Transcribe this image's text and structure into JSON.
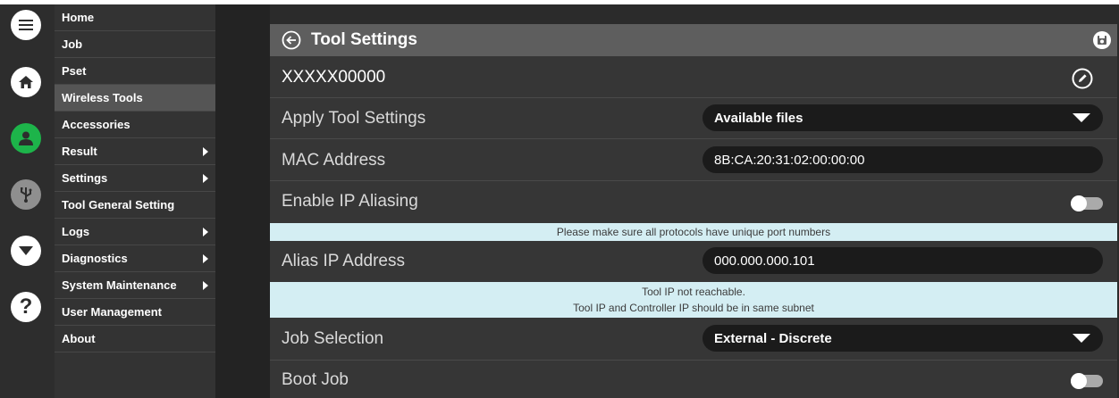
{
  "sidebar": {
    "icons": [
      {
        "name": "hamburger-menu-icon"
      },
      {
        "name": "home-icon"
      },
      {
        "name": "user-icon",
        "color": "#1db44a"
      },
      {
        "name": "usb-icon"
      },
      {
        "name": "dropdown-circle-icon"
      },
      {
        "name": "help-icon"
      }
    ],
    "menu": [
      {
        "label": "Home",
        "arrow": false,
        "active": false
      },
      {
        "label": "Job",
        "arrow": false,
        "active": false
      },
      {
        "label": "Pset",
        "arrow": false,
        "active": false
      },
      {
        "label": "Wireless Tools",
        "arrow": false,
        "active": true
      },
      {
        "label": "Accessories",
        "arrow": false,
        "active": false
      },
      {
        "label": "Result",
        "arrow": true,
        "active": false
      },
      {
        "label": "Settings",
        "arrow": true,
        "active": false
      },
      {
        "label": "Tool General Setting",
        "arrow": false,
        "active": false
      },
      {
        "label": "Logs",
        "arrow": true,
        "active": false
      },
      {
        "label": "Diagnostics",
        "arrow": true,
        "active": false
      },
      {
        "label": "System Maintenance",
        "arrow": true,
        "active": false
      },
      {
        "label": "User Management",
        "arrow": false,
        "active": false
      },
      {
        "label": "About",
        "arrow": false,
        "active": false
      }
    ]
  },
  "panel": {
    "title": "Tool Settings",
    "tool_id": "XXXXX00000",
    "apply_settings": {
      "label": "Apply Tool Settings",
      "value": "Available files"
    },
    "mac": {
      "label": "MAC Address",
      "value": "8B:CA:20:31:02:00:00:00"
    },
    "ip_aliasing": {
      "label": "Enable IP Aliasing",
      "enabled": false
    },
    "notice_ports": "Please make sure all protocols have unique port numbers",
    "alias_ip": {
      "label": "Alias IP Address",
      "value": "000.000.000.101"
    },
    "notice_ip_line1": "Tool IP not reachable.",
    "notice_ip_line2": "Tool IP and Controller IP should be in same subnet",
    "job_selection": {
      "label": "Job Selection",
      "value": "External - Discrete"
    },
    "boot_job": {
      "label": "Boot Job",
      "enabled": false
    }
  },
  "colors": {
    "accent_green": "#1db44a",
    "notice_bg": "#d4eef3",
    "titlebar": "#5e5e5e"
  }
}
